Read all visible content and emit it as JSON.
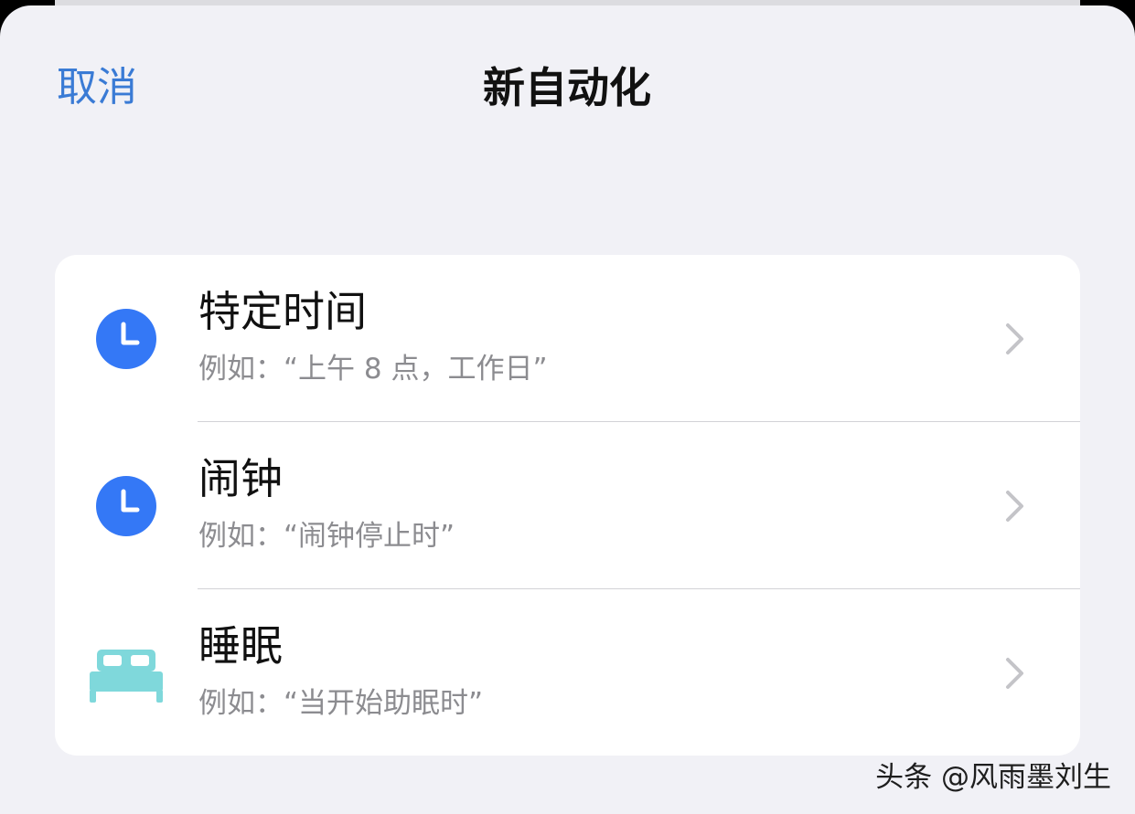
{
  "header": {
    "cancel_label": "取消",
    "title": "新自动化"
  },
  "list": {
    "items": [
      {
        "icon": "clock-icon",
        "title": "特定时间",
        "subtitle": "例如：“上午 8 点，工作日”"
      },
      {
        "icon": "clock-icon",
        "title": "闹钟",
        "subtitle": "例如：“闹钟停止时”"
      },
      {
        "icon": "bed-icon",
        "title": "睡眠",
        "subtitle": "例如：“当开始助眠时”"
      }
    ]
  },
  "watermark": "头条 @风雨墨刘生",
  "colors": {
    "accent": "#3a7bd5",
    "clock_icon": "#3478f6",
    "bed_icon": "#7fd8db",
    "chevron": "#c4c4c8",
    "background": "#f1f1f6"
  }
}
